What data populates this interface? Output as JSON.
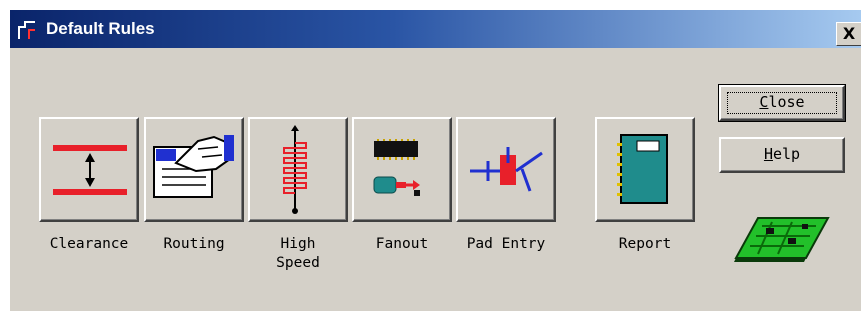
{
  "window": {
    "title": "Default Rules",
    "close_glyph": "X"
  },
  "tools": [
    {
      "label": "Clearance",
      "icon": "clearance-icon"
    },
    {
      "label": "Routing",
      "icon": "routing-icon"
    },
    {
      "label": "High\nSpeed",
      "icon": "high-speed-icon"
    },
    {
      "label": "Fanout",
      "icon": "fanout-icon"
    },
    {
      "label": "Pad Entry",
      "icon": "pad-entry-icon"
    },
    {
      "label": "Report",
      "icon": "report-icon"
    }
  ],
  "buttons": {
    "close": {
      "label": "Close",
      "mnemonic": "C"
    },
    "help": {
      "label": "Help",
      "mnemonic": "H"
    }
  },
  "decor": {
    "board_icon": "pcb-board-icon"
  },
  "colors": {
    "face": "#d4d0c8",
    "title_start": "#0a246a",
    "title_end": "#a6caf0",
    "accent_red": "#e8202a",
    "accent_blue": "#2030d0",
    "board_green": "#22c02a",
    "report_teal": "#1f8c8c"
  }
}
